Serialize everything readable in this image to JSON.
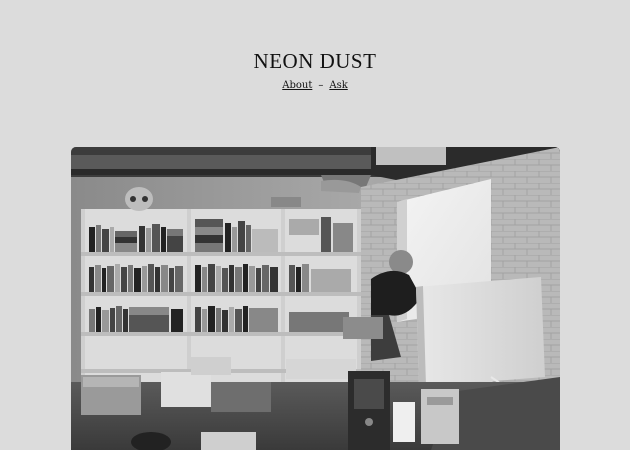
{
  "site": {
    "title": "NEON DUST"
  },
  "nav": {
    "about_label": "About",
    "separator": "–",
    "ask_label": "Ask"
  },
  "post": {
    "photo_description_icon": "photo-image"
  },
  "colors": {
    "background": "#dcdcdc",
    "text": "#111111"
  }
}
